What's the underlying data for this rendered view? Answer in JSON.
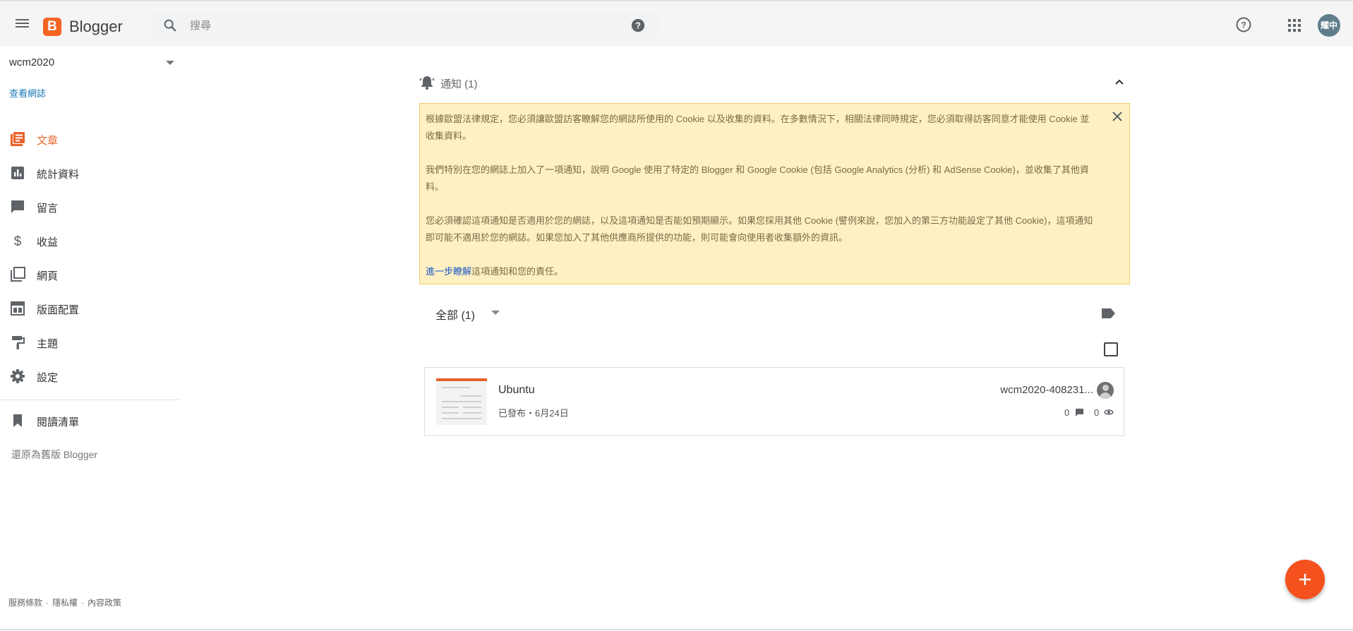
{
  "app": {
    "title": "Blogger",
    "logo_letter": "B",
    "user_initials": "耀中"
  },
  "search": {
    "placeholder": "搜尋"
  },
  "sidebar": {
    "blog_name": "wcm2020",
    "view_blog": "查看網誌",
    "items": [
      {
        "label": "文章",
        "icon": "posts-icon",
        "active": true
      },
      {
        "label": "統計資料",
        "icon": "stats-icon"
      },
      {
        "label": "留言",
        "icon": "comment-icon"
      },
      {
        "label": "收益",
        "icon": "dollar-icon"
      },
      {
        "label": "網頁",
        "icon": "pages-icon"
      },
      {
        "label": "版面配置",
        "icon": "layout-icon"
      },
      {
        "label": "主題",
        "icon": "theme-icon"
      },
      {
        "label": "設定",
        "icon": "gear-icon"
      }
    ],
    "reading_list": "閱讀清單",
    "revert": "還原為舊版 Blogger",
    "footer": {
      "terms": "服務條款",
      "privacy": "隱私權",
      "content_policy": "內容政策"
    }
  },
  "notifications": {
    "title": "通知 (1)",
    "paragraphs": [
      "根據歐盟法律規定，您必須讓歐盟訪客瞭解您的網誌所使用的 Cookie 以及收集的資料。在多數情況下，相關法律同時規定，您必須取得訪客同意才能使用 Cookie 並收集資料。",
      "我們特別在您的網誌上加入了一項通知，說明 Google 使用了特定的 Blogger 和 Google Cookie (包括 Google Analytics (分析) 和 AdSense Cookie)，並收集了其他資料。",
      "您必須確認這項通知是否適用於您的網誌，以及這項通知是否能如預期顯示。如果您採用其他 Cookie (譬例來說，您加入的第三方功能設定了其他 Cookie)，這項通知即可能不適用於您的網誌。如果您加入了其他供應商所提供的功能，則可能會向使用者收集額外的資訊。"
    ],
    "learn_more_link": "進一步瞭解",
    "learn_more_rest": "這項通知和您的責任。"
  },
  "posts": {
    "filter": "全部 (1)",
    "items": [
      {
        "title": "Ubuntu",
        "status": "已發布・6月24日",
        "blog": "wcm2020-408231...",
        "comments": "0",
        "views": "0"
      }
    ]
  },
  "colors": {
    "accent": "#e8622a",
    "logo": "#f46524",
    "fab": "#f4511e",
    "notice_bg": "#fff0c3",
    "link": "#1a7ab9"
  }
}
